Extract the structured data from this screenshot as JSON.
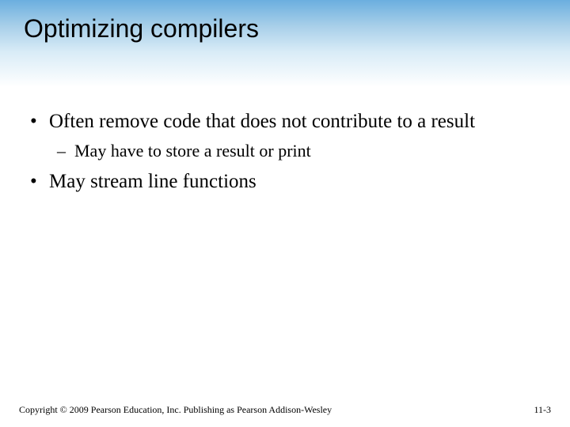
{
  "title": "Optimizing compilers",
  "bullets": [
    {
      "level": 1,
      "text": "Often remove code that does not contribute to a result"
    },
    {
      "level": 2,
      "text": "May have to store a result or print"
    },
    {
      "level": 1,
      "text": "May stream line functions"
    }
  ],
  "footer": {
    "copyright": "Copyright © 2009 Pearson Education, Inc. Publishing as Pearson Addison-Wesley",
    "page": "11-3"
  }
}
